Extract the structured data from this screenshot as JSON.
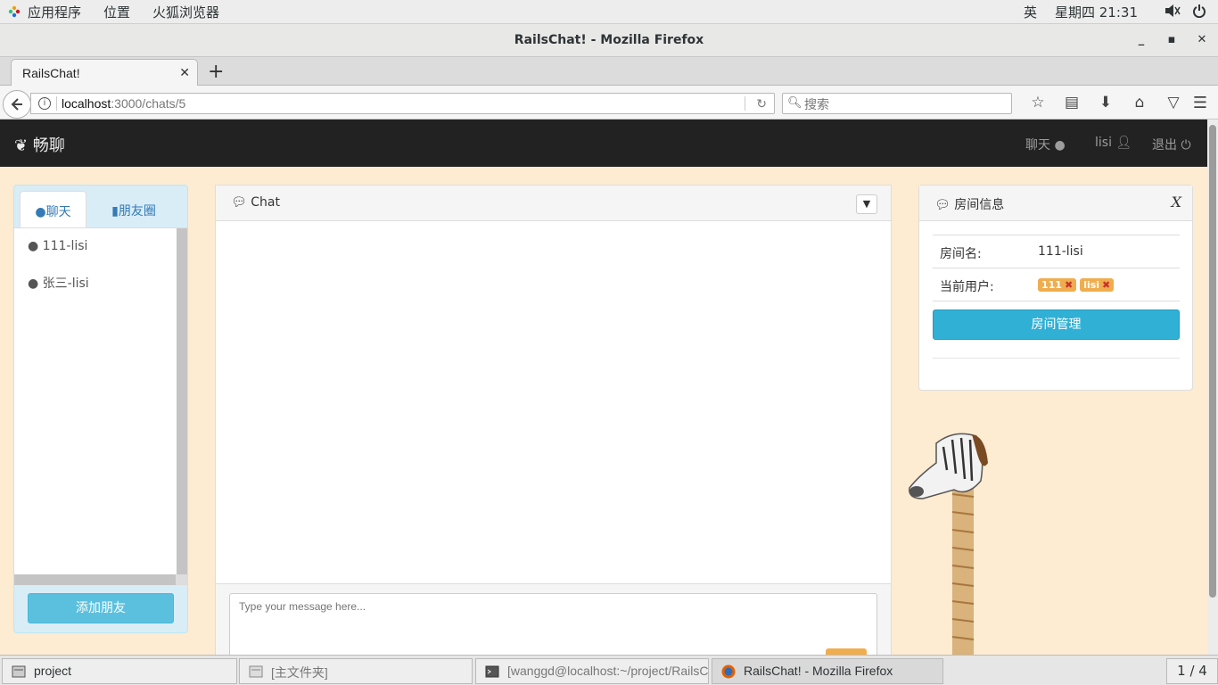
{
  "system": {
    "apps_menu": "应用程序",
    "places_menu": "位置",
    "browser_menu": "火狐浏览器",
    "input_method": "英",
    "clock": "星期四 21:31"
  },
  "window": {
    "title": "RailsChat! - Mozilla Firefox"
  },
  "browser": {
    "tab_title": "RailsChat!",
    "url_host": "localhost",
    "url_path": ":3000/chats/5",
    "search_placeholder": "搜索"
  },
  "app": {
    "brand": "畅聊",
    "nav": {
      "chat": "聊天",
      "user": "lisi",
      "logout": "退出"
    }
  },
  "sidebar": {
    "tabs": [
      "聊天",
      "朋友圈"
    ],
    "friends": [
      "111-lisi",
      "张三-lisi"
    ],
    "add_friend": "添加朋友"
  },
  "chat": {
    "title": "Chat",
    "input_placeholder": "Type your message here..."
  },
  "room": {
    "title": "房间信息",
    "close": "X",
    "name_label": "房间名:",
    "name_value": "111-lisi",
    "users_label": "当前用户:",
    "users": [
      "111",
      "lisi"
    ],
    "manage_button": "房间管理"
  },
  "taskbar": {
    "items": [
      "project",
      "[主文件夹]",
      "[wanggd@localhost:~/project/RailsC...",
      "RailsChat! - Mozilla Firefox"
    ],
    "workspace": "1 / 4"
  }
}
